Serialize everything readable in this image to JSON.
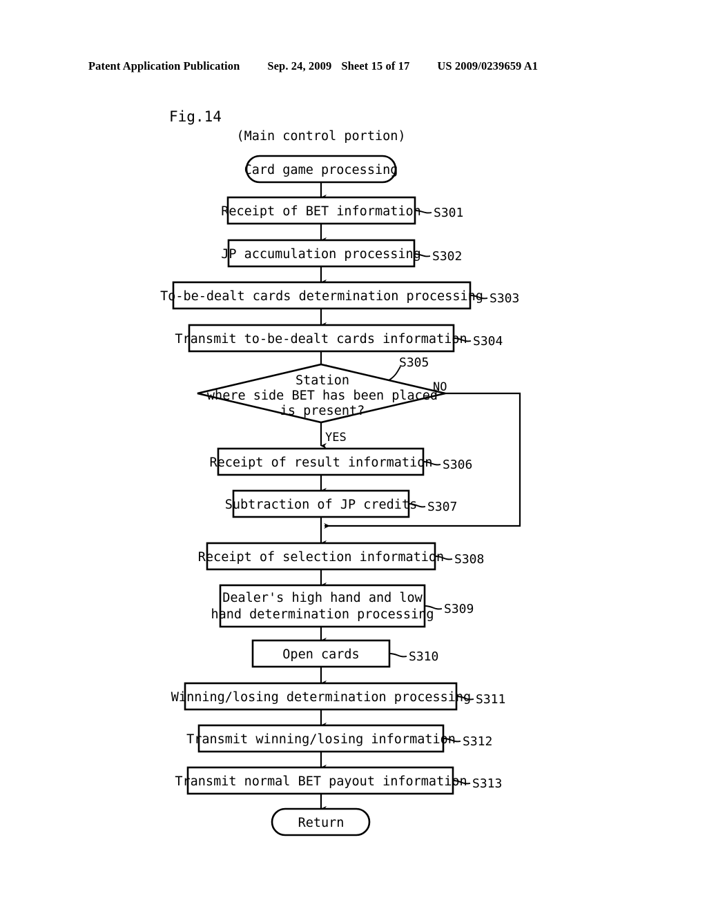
{
  "header": {
    "publication": "Patent Application Publication",
    "date": "Sep. 24, 2009",
    "sheet": "Sheet 15 of 17",
    "patent_number": "US 2009/0239659 A1"
  },
  "figure": {
    "label": "Fig.14",
    "subtitle": "(Main control portion)"
  },
  "flowchart": {
    "start": {
      "text": "Card game processing"
    },
    "end": {
      "text": "Return"
    },
    "steps": [
      {
        "id": "S301",
        "text": "Receipt of BET information"
      },
      {
        "id": "S302",
        "text": "JP accumulation processing"
      },
      {
        "id": "S303",
        "text": "To-be-dealt cards determination processing"
      },
      {
        "id": "S304",
        "text": "Transmit to-be-dealt cards information"
      },
      {
        "id": "S306",
        "text": "Receipt of result information"
      },
      {
        "id": "S307",
        "text": "Subtraction of JP credits"
      },
      {
        "id": "S308",
        "text": "Receipt of selection information"
      },
      {
        "id": "S309",
        "text_line1": "Dealer's high hand and low",
        "text_line2": "hand determination processing"
      },
      {
        "id": "S310",
        "text": "Open cards"
      },
      {
        "id": "S311",
        "text": "Winning/losing determination processing"
      },
      {
        "id": "S312",
        "text": "Transmit winning/losing information"
      },
      {
        "id": "S313",
        "text": "Transmit normal BET payout information"
      }
    ],
    "decision": {
      "id": "S305",
      "text_line1": "Station",
      "text_line2": "where side BET has been placed",
      "text_line3": "is present?",
      "branch_yes": "YES",
      "branch_no": "NO"
    }
  },
  "colors": {
    "ink": "#000000",
    "paper": "#ffffff"
  }
}
